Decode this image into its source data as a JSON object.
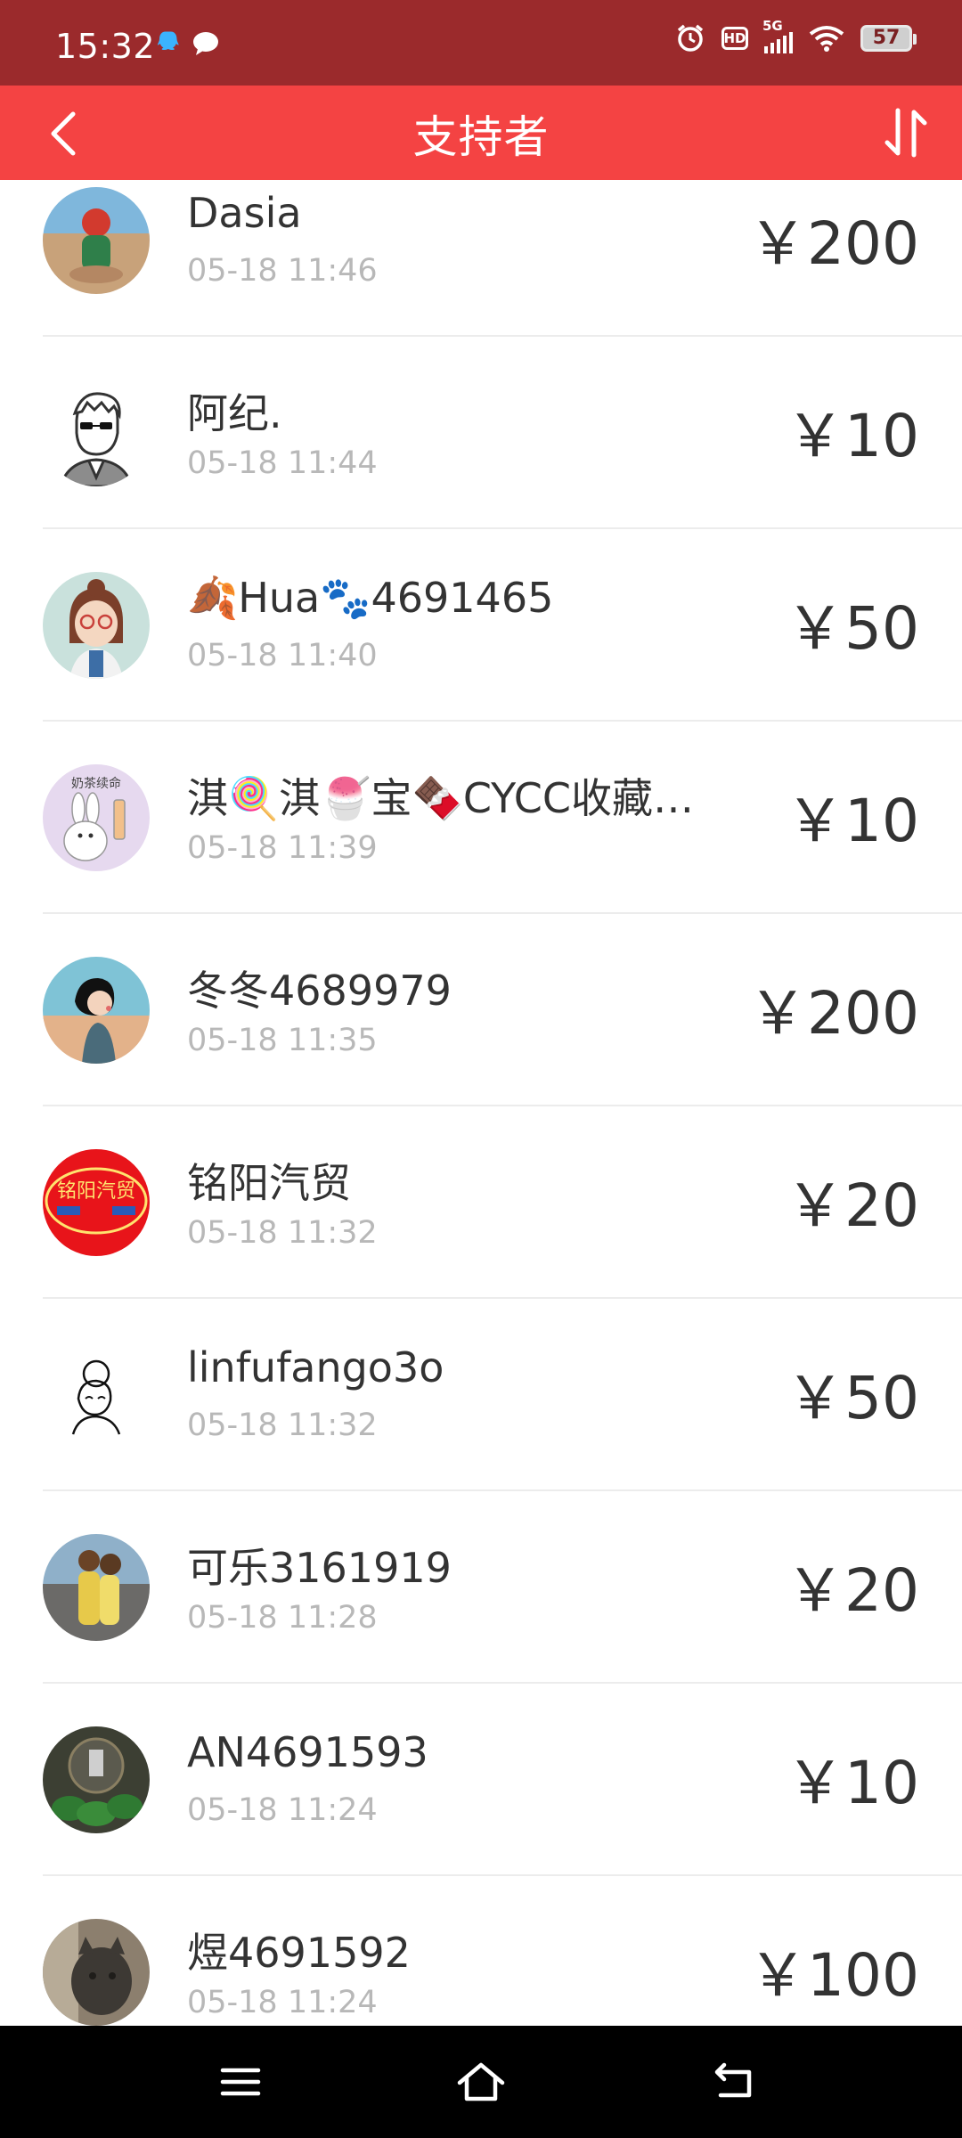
{
  "status_bar": {
    "time": "15:32",
    "network": "5G",
    "hd": "HD",
    "battery": "57",
    "icons": [
      "qq-icon",
      "message-icon",
      "alarm-icon",
      "hd-icon",
      "signal-icon",
      "wifi-icon",
      "battery-icon"
    ]
  },
  "header": {
    "title": "支持者",
    "back_icon": "chevron-left-icon",
    "sort_icon": "sort-icon",
    "background": "#f44343"
  },
  "supporters": [
    {
      "name": "Dasia",
      "time": "05-18 11:46",
      "amount": "￥200"
    },
    {
      "name": "阿纪.",
      "time": "05-18 11:44",
      "amount": "￥10"
    },
    {
      "name": "🍂Hua🐾4691465",
      "time": "05-18 11:40",
      "amount": "￥50"
    },
    {
      "name": "淇🍭淇🍧宝🍫CYCC收藏…",
      "time": "05-18 11:39",
      "amount": "￥10"
    },
    {
      "name": "冬冬4689979",
      "time": "05-18 11:35",
      "amount": "￥200"
    },
    {
      "name": "铭阳汽贸",
      "time": "05-18 11:32",
      "amount": "￥20"
    },
    {
      "name": "linfufango3o",
      "time": "05-18 11:32",
      "amount": "￥50"
    },
    {
      "name": "可乐3161919",
      "time": "05-18 11:28",
      "amount": "￥20"
    },
    {
      "name": "AN4691593",
      "time": "05-18 11:24",
      "amount": "￥10"
    },
    {
      "name": "煜4691592",
      "time": "05-18 11:24",
      "amount": "￥100"
    }
  ],
  "avatar_text": {
    "logo_top": "铭阳汽贸",
    "milk_tea": "奶茶续命"
  },
  "nav_bar": {
    "icons": [
      "menu-icon",
      "home-icon",
      "back-icon"
    ]
  },
  "colors": {
    "status_bar": "#9b2a2c",
    "accent": "#f44343",
    "primary_text": "#333333",
    "secondary_text": "#b8b8b8"
  }
}
